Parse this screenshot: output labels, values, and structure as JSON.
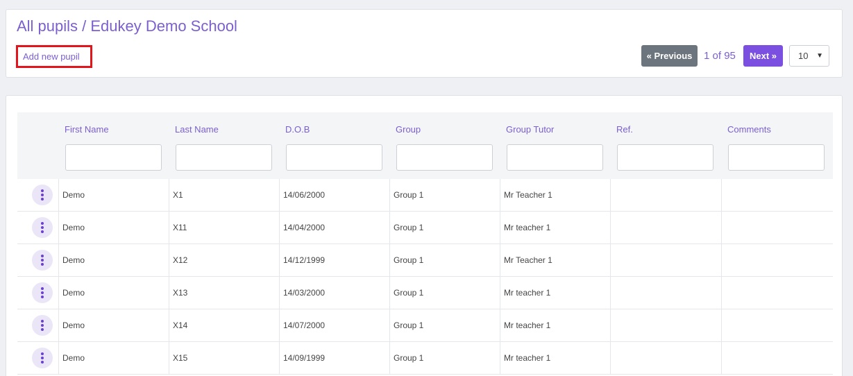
{
  "header": {
    "title": "All pupils / Edukey Demo School",
    "add_link": "Add new pupil"
  },
  "pagination": {
    "previous_label": "« Previous",
    "current": "1",
    "of_label": "of",
    "total": "95",
    "next_label": "Next »",
    "page_size": "10"
  },
  "table": {
    "columns": [
      "First Name",
      "Last Name",
      "D.O.B",
      "Group",
      "Group Tutor",
      "Ref.",
      "Comments"
    ],
    "rows": [
      {
        "first": "Demo",
        "last": "X1",
        "dob": "14/06/2000",
        "group": "Group 1",
        "tutor": "Mr Teacher 1",
        "ref": "",
        "comments": ""
      },
      {
        "first": "Demo",
        "last": "X11",
        "dob": "14/04/2000",
        "group": "Group 1",
        "tutor": "Mr teacher 1",
        "ref": "",
        "comments": ""
      },
      {
        "first": "Demo",
        "last": "X12",
        "dob": "14/12/1999",
        "group": "Group 1",
        "tutor": "Mr Teacher 1",
        "ref": "",
        "comments": ""
      },
      {
        "first": "Demo",
        "last": "X13",
        "dob": "14/03/2000",
        "group": "Group 1",
        "tutor": "Mr teacher 1",
        "ref": "",
        "comments": ""
      },
      {
        "first": "Demo",
        "last": "X14",
        "dob": "14/07/2000",
        "group": "Group 1",
        "tutor": "Mr teacher 1",
        "ref": "",
        "comments": ""
      },
      {
        "first": "Demo",
        "last": "X15",
        "dob": "14/09/1999",
        "group": "Group 1",
        "tutor": "Mr teacher 1",
        "ref": "",
        "comments": ""
      }
    ]
  },
  "icons": {
    "row_menu": "vertical-ellipsis-icon",
    "select_caret": "caret-down-icon"
  },
  "colors": {
    "accent": "#7b5fcf",
    "next_button": "#7b4fe0",
    "prev_button": "#6c757d",
    "highlight_border": "#e2141c"
  }
}
